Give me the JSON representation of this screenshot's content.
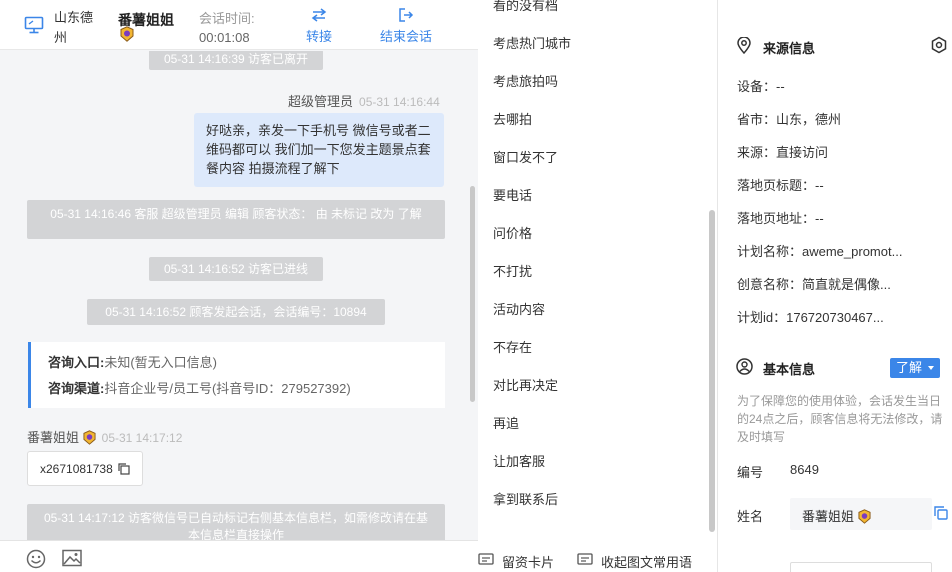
{
  "header": {
    "location": "山东德州",
    "visitor_name": "番薯姐姐",
    "session_time_label": "会话时间:",
    "session_time_value": "00:01:08",
    "transfer_label": "转接",
    "end_label": "结束会话"
  },
  "chat": {
    "messages": [
      {
        "type": "system",
        "text": "05-31 14:16:39 访客已离开"
      },
      {
        "type": "agent",
        "sender": "超级管理员",
        "time": "05-31 14:16:44",
        "text": "好哒亲，亲发一下手机号 微信号或者二维码都可以 我们加一下您发主题景点套餐内容 拍摄流程了解下"
      },
      {
        "type": "system",
        "text": "05-31 14:16:46 客服 超级管理员 编辑 顾客状态： 由 未标记 改为 了解"
      },
      {
        "type": "system",
        "text": "05-31 14:16:52 访客已进线"
      },
      {
        "type": "system",
        "text": "05-31 14:16:52 顾客发起会话，会话编号：10894"
      },
      {
        "type": "system",
        "text": "05-31 14:17:12 访客微信号已自动标记右侧基本信息栏，如需修改请在基本信息栏直接操作"
      }
    ],
    "entry_card": {
      "entry_label": "咨询入口:",
      "entry_value": "未知(暂无入口信息)",
      "channel_label": "咨询渠道:",
      "channel_value": "抖音企业号/员工号(抖音号ID：279527392)"
    },
    "visitor_msg": {
      "sender": "番薯姐姐",
      "time": "05-31 14:17:12",
      "wechat": "x2671081738"
    }
  },
  "phrases": {
    "items": [
      "看的没有档",
      "考虑热门城市",
      "考虑旅拍吗",
      "去哪拍",
      "窗口发不了",
      "要电话",
      "问价格",
      "不打扰",
      "活动内容",
      "不存在",
      "对比再决定",
      "再追",
      "让加客服",
      "拿到联系后"
    ],
    "leave_card_label": "留资卡片",
    "collapse_label": "收起图文常用语"
  },
  "info": {
    "source_title": "来源信息",
    "device": "设备：--",
    "province_city": "省市：山东，德州",
    "source": "来源：直接访问",
    "landing_title": "落地页标题：--",
    "landing_url": "落地页地址：--",
    "plan_name": "计划名称：aweme_promot...",
    "creative_name": "创意名称：简直就是偶像...",
    "plan_id": "计划id：176720730467...",
    "basic_title": "基本信息",
    "learn_label": "了解",
    "notice": "为了保障您的使用体验，会话发生当日的24点之后，顾客信息将无法修改，请及时填写",
    "number_label": "编号",
    "number_value": "8649",
    "name_label": "姓名",
    "name_value": "番薯姐姐"
  },
  "colors": {
    "accent": "#3b86e8",
    "agent_bubble": "#dde9fb",
    "system_pill": "#d3d4d6",
    "chat_bg": "#f4f5f7"
  }
}
